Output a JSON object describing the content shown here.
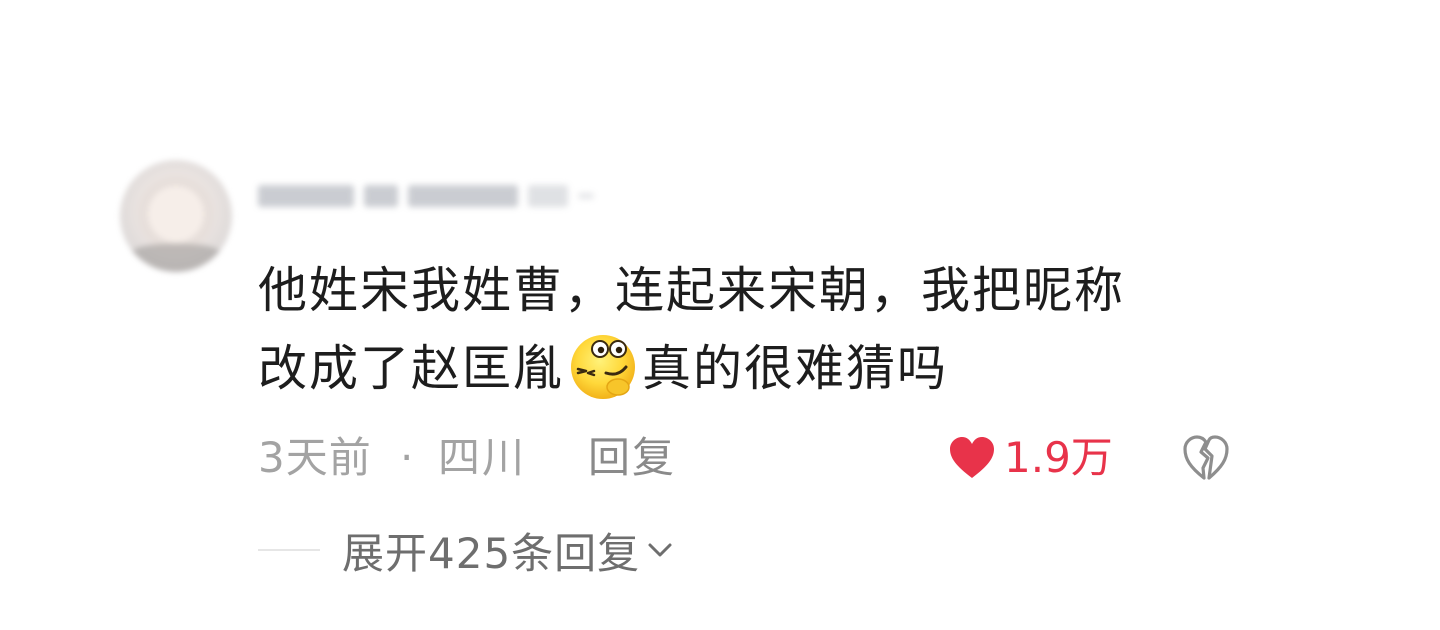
{
  "comment": {
    "avatar_icon": "user-avatar-blurred",
    "text_line1": "他姓宋我姓曹，连起来宋朝，我把昵称",
    "text_line2_before": "改成了赵匡胤",
    "emoji_icon": "sly-smirk-emoji",
    "text_line2_after": "真的很难猜吗",
    "time": "3天前",
    "separator": "·",
    "location": "四川",
    "reply_label": "回复",
    "like_icon": "heart-filled-icon",
    "like_count": "1.9万",
    "like_color": "#e8334a",
    "dislike_icon": "broken-heart-icon",
    "expand_label": "展开425条回复",
    "expand_icon": "chevron-down-icon"
  }
}
